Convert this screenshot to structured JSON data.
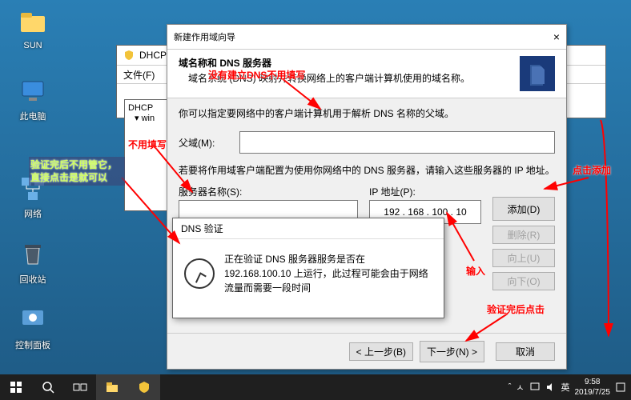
{
  "desktop": {
    "icons": [
      "SUN",
      "此电脑",
      "网络",
      "回收站",
      "控制面板"
    ]
  },
  "annotations": {
    "a1": "没有建立DNS不用填写",
    "a2": "不用填写",
    "a3": "验证完后不用管它，直接点击是就可以",
    "a4": "点击添加",
    "a5": "输入",
    "a6": "验证完后点击"
  },
  "bgwin": {
    "title": "DHCP",
    "menu_file": "文件(F)",
    "tree1": "DHCP",
    "tree2": "win"
  },
  "wizard": {
    "title": "新建作用域向导",
    "close": "×",
    "head1": "域名称和 DNS 服务器",
    "head2": "域名系统 (DNS) 映射并转换网络上的客户端计算机使用的域名称。",
    "body_intro": "你可以指定要网络中的客户端计算机用于解析 DNS 名称的父域。",
    "parent_label": "父域(M):",
    "parent_value": "",
    "body_mid": "若要将作用域客户端配置为使用你网络中的 DNS 服务器，请输入这些服务器的 IP 地址。",
    "server_label": "服务器名称(S):",
    "server_value": "",
    "ip_label": "IP 地址(P):",
    "ip_value": "192 . 168 . 100 . 10",
    "btn_add": "添加(D)",
    "btn_del": "删除(R)",
    "btn_up": "向上(U)",
    "btn_down": "向下(O)",
    "btn_back": "< 上一步(B)",
    "btn_next": "下一步(N) >",
    "btn_cancel": "取消"
  },
  "dns_dialog": {
    "title": "DNS 验证",
    "message": "正在验证 DNS 服务器服务是否在 192.168.100.10 上运行，此过程可能会由于网络流量而需要一段时间"
  },
  "taskbar": {
    "ime1": "ㅅ",
    "ime2": "英",
    "time": "9:58",
    "date": "2019/7/25"
  }
}
